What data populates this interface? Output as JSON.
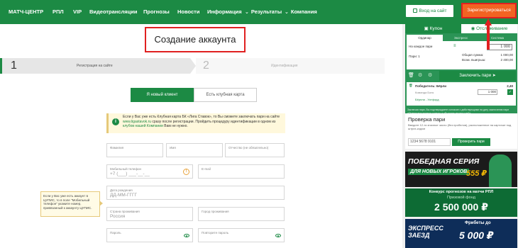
{
  "nav": {
    "items": [
      "МАТЧ-ЦЕНТР",
      "РПЛ",
      "VIP",
      "Видеотрансляции",
      "Прогнозы",
      "Новости",
      "Информация",
      "Результаты",
      "Компания"
    ],
    "login": "Вход на сайт",
    "register": "Зарегистрироваться"
  },
  "main": {
    "title": "Создание аккаунта",
    "steps": [
      {
        "num": "1",
        "label": "Регистрация на сайте"
      },
      {
        "num": "2",
        "label": "Идентификация"
      }
    ],
    "tabs": [
      "Я новый клиент",
      "Есть клубная карта"
    ],
    "info": {
      "part1": "Если у Вас уже есть Клубная карта БК «Лига Ставок», то Вы сможете заключать пари на сайте ",
      "site": "www.ligastavok.ru",
      "part2": " сразу после регистрации. Пройдить процедуру идентификации в одном из ",
      "clubs": "клубов нашей Компании",
      "part3": " Вам не нужно."
    },
    "fields": {
      "lastname": "Фамилия",
      "firstname": "Имя",
      "patronymic": "Отчество (не обязательно)",
      "phone_label": "Мобильный телефон",
      "phone_value": "+7 (___) ___-__-__",
      "email": "E-mail",
      "dob_label": "Дата рождения",
      "dob_value": "ДД-ММ-ГГГГ",
      "country_label": "Страна проживания",
      "country_value": "Россия",
      "city": "Город проживания",
      "password": "Пароль",
      "password_repeat": "Повторите пароль"
    },
    "hint": "Если у Вас уже есть аккаунт в ЦУПИС, то в поле \"Мобильный телефон\" укажите номер, привязанный к аккаунту ЦУПИС."
  },
  "sidebar": {
    "coupon_tab": "Купон",
    "tracking_tab": "Отслеживание",
    "coupon_types": [
      "Ординар",
      "Экспресс",
      "Система"
    ],
    "per_bet_label": "На каждое пари",
    "per_bet_value": "1 000",
    "bets_label": "Пари: 1",
    "total_label": "Общая сумма:",
    "total_value": "1 000,00",
    "win_label": "Возм. выигрыш:",
    "win_value": "2 400,00",
    "conclude": "Заключить пари",
    "selection": "Победитель: Бёрли",
    "selection_odds": "2,40",
    "selection_note": "Команда Бонк",
    "selection_sum": "1 000",
    "selection_sub": "Бёрнли - Уотфорд",
    "coupon_note": "Заключая пари, Вы подтверждаете согласие с действующими на дату заключения пари «Правилами приема ставок» и «Выплаты выигрышей»",
    "check_title": "Проверка пари",
    "check_sub": "Введите 12-ти значное число (без пробелов), расположенное на карточке под штрих-кодом",
    "check_value": "1234 5678 9101",
    "check_btn": "Проверить пари",
    "banner1_line1": "ПОБЕДНАЯ СЕРИЯ",
    "banner1_line2": "ДЛЯ НОВЫХ ИГРОКОВ",
    "banner1_amount": "555 ₽",
    "banner2_line1": "Конкурс прогнозов на матчи РПЛ",
    "banner2_line2": "Призовой фонд",
    "banner2_amount": "2 500 000 ₽",
    "banner3_line1": "ЭКСПРЕСС ЗАЕЗД",
    "banner3_line2": "Фрибеты до",
    "banner3_amount": "5 000 ₽"
  }
}
